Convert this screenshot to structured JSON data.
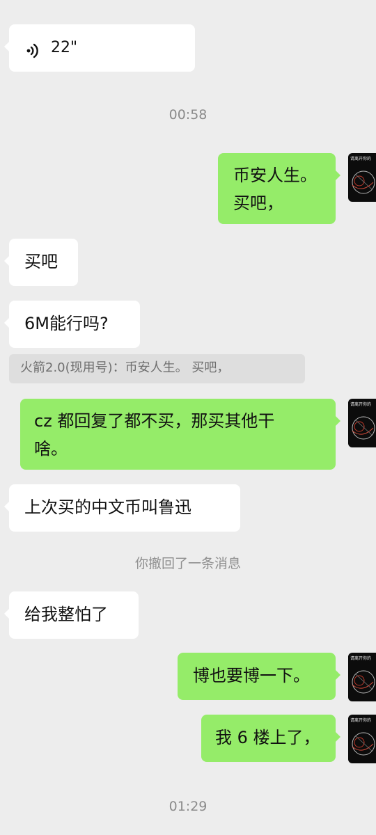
{
  "messages": {
    "voice": {
      "duration": "22\""
    },
    "time1": "00:58",
    "m1": {
      "line1": "币安人生。",
      "line2": "买吧，"
    },
    "m2": "买吧",
    "m3": "6M能行吗?",
    "quote1": "火箭2.0(现用号)：币安人生。 买吧，",
    "m4": {
      "line1": "cz 都回复了都不买，那买其他干",
      "line2": "啥。"
    },
    "m5": "上次买的中文币叫鲁迅",
    "recall": "你撤回了一条消息",
    "m6": "给我整怕了",
    "m7": "博也要博一下。",
    "m8": "我 6 楼上了，",
    "time2": "01:29"
  },
  "avatar": {
    "header_text": "请离开你的"
  },
  "colors": {
    "background": "#ededed",
    "incoming_bubble": "#ffffff",
    "outgoing_bubble": "#95ec69",
    "quote_bg": "#dedede"
  }
}
